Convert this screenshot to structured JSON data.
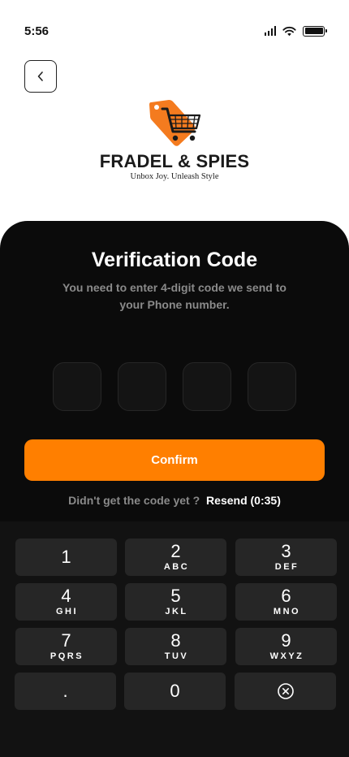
{
  "status_bar": {
    "time": "5:56",
    "icons": [
      "cellular-signal-icon",
      "wifi-icon",
      "battery-icon"
    ]
  },
  "header": {
    "back_icon": "chevron-left-icon"
  },
  "brand": {
    "name": "FRADEL & SPIES",
    "tagline": "Unbox Joy. Unleash Style",
    "logo_icon": "shopping-cart-tag-icon"
  },
  "verification": {
    "title": "Verification Code",
    "subtitle": "You need to enter 4-digit code we send to your Phone number.",
    "code_digits": [
      "",
      "",
      "",
      ""
    ],
    "confirm_label": "Confirm",
    "resend_prompt": "Didn't get the code yet ?",
    "resend_label": "Resend (0:35)"
  },
  "keypad": {
    "keys": [
      {
        "digit": "1",
        "letters": ""
      },
      {
        "digit": "2",
        "letters": "ABC"
      },
      {
        "digit": "3",
        "letters": "DEF"
      },
      {
        "digit": "4",
        "letters": "GHI"
      },
      {
        "digit": "5",
        "letters": "JKL"
      },
      {
        "digit": "6",
        "letters": "MNO"
      },
      {
        "digit": "7",
        "letters": "PQRS"
      },
      {
        "digit": "8",
        "letters": "TUV"
      },
      {
        "digit": "9",
        "letters": "WXYZ"
      },
      {
        "digit": ".",
        "letters": ""
      },
      {
        "digit": "0",
        "letters": ""
      }
    ],
    "delete_icon": "delete-circle-x-icon"
  },
  "colors": {
    "accent": "#ff7f00",
    "sheet_background": "#0b0b0b",
    "keypad_background": "#121212",
    "key_background": "#262626",
    "muted_text": "#8a8a8a"
  }
}
